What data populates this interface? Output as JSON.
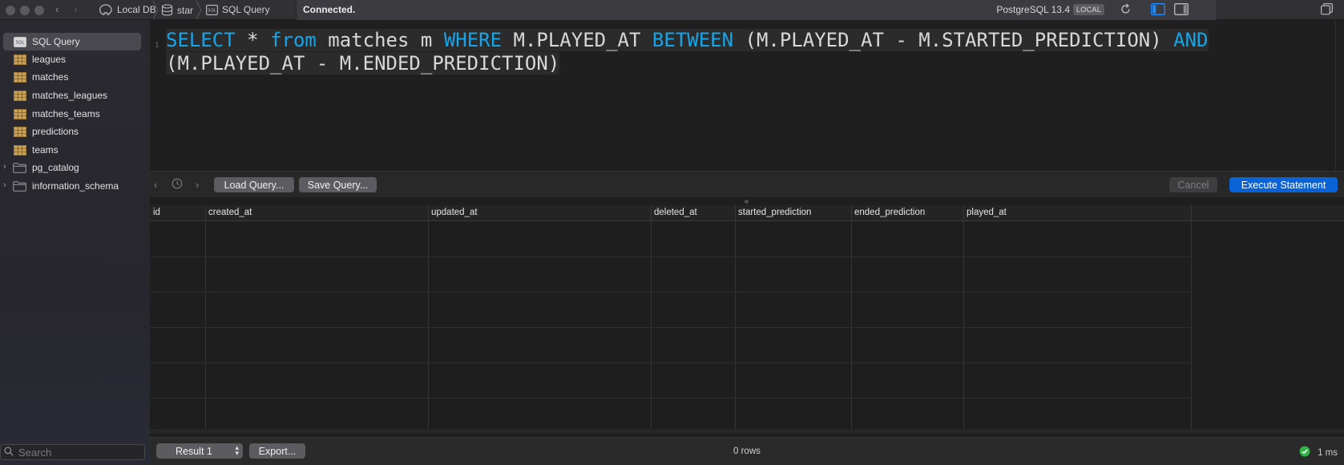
{
  "toolbar": {
    "breadcrumbs": [
      {
        "label": "Local DB",
        "icon": "elephant-icon"
      },
      {
        "label": "star",
        "icon": "database-icon"
      },
      {
        "label": "SQL Query",
        "icon": "sql-query-icon"
      }
    ],
    "status": "Connected.",
    "server_version": "PostgreSQL 13.4",
    "env_badge": "LOCAL"
  },
  "sidebar": {
    "items": [
      {
        "label": "SQL Query",
        "icon": "sql-query-icon",
        "selected": true
      },
      {
        "label": "leagues",
        "icon": "table-icon"
      },
      {
        "label": "matches",
        "icon": "table-icon"
      },
      {
        "label": "matches_leagues",
        "icon": "table-icon"
      },
      {
        "label": "matches_teams",
        "icon": "table-icon"
      },
      {
        "label": "predictions",
        "icon": "table-icon"
      },
      {
        "label": "teams",
        "icon": "table-icon"
      },
      {
        "label": "pg_catalog",
        "icon": "folder-icon"
      },
      {
        "label": "information_schema",
        "icon": "folder-icon"
      }
    ],
    "search_placeholder": "Search"
  },
  "editor": {
    "line_number": "1",
    "tokens": [
      {
        "t": "SELECT",
        "kw": true
      },
      {
        "t": " * ",
        "kw": false
      },
      {
        "t": "from",
        "kw": true
      },
      {
        "t": " matches m ",
        "kw": false
      },
      {
        "t": "WHERE",
        "kw": true
      },
      {
        "t": " M.PLAYED_AT ",
        "kw": false
      },
      {
        "t": "BETWEEN",
        "kw": true
      },
      {
        "t": " (M.PLAYED_AT - M.STARTED_PREDICTION) ",
        "kw": false
      },
      {
        "t": "AND",
        "kw": true
      },
      {
        "t": " (M.PLAYED_AT - M.ENDED_PREDICTION)",
        "kw": false
      }
    ]
  },
  "actions": {
    "load_query": "Load Query...",
    "save_query": "Save Query...",
    "cancel": "Cancel",
    "execute": "Execute Statement"
  },
  "results": {
    "columns": [
      "id",
      "created_at",
      "updated_at",
      "deleted_at",
      "started_prediction",
      "ended_prediction",
      "played_at"
    ],
    "rows": [],
    "result_selector": "Result 1",
    "export": "Export...",
    "row_count": "0 rows",
    "duration": "1 ms"
  },
  "colors": {
    "keyword": "#14a5ea",
    "accent_button": "#0a63d6",
    "success": "#2fb347"
  }
}
